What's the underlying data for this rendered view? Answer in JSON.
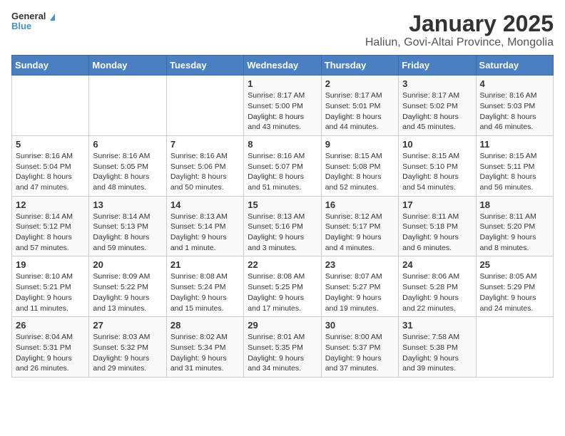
{
  "logo": {
    "general": "General",
    "blue": "Blue"
  },
  "title": "January 2025",
  "subtitle": "Haliun, Govi-Altai Province, Mongolia",
  "days_of_week": [
    "Sunday",
    "Monday",
    "Tuesday",
    "Wednesday",
    "Thursday",
    "Friday",
    "Saturday"
  ],
  "weeks": [
    [
      {
        "day": "",
        "info": ""
      },
      {
        "day": "",
        "info": ""
      },
      {
        "day": "",
        "info": ""
      },
      {
        "day": "1",
        "info": "Sunrise: 8:17 AM\nSunset: 5:00 PM\nDaylight: 8 hours\nand 43 minutes."
      },
      {
        "day": "2",
        "info": "Sunrise: 8:17 AM\nSunset: 5:01 PM\nDaylight: 8 hours\nand 44 minutes."
      },
      {
        "day": "3",
        "info": "Sunrise: 8:17 AM\nSunset: 5:02 PM\nDaylight: 8 hours\nand 45 minutes."
      },
      {
        "day": "4",
        "info": "Sunrise: 8:16 AM\nSunset: 5:03 PM\nDaylight: 8 hours\nand 46 minutes."
      }
    ],
    [
      {
        "day": "5",
        "info": "Sunrise: 8:16 AM\nSunset: 5:04 PM\nDaylight: 8 hours\nand 47 minutes."
      },
      {
        "day": "6",
        "info": "Sunrise: 8:16 AM\nSunset: 5:05 PM\nDaylight: 8 hours\nand 48 minutes."
      },
      {
        "day": "7",
        "info": "Sunrise: 8:16 AM\nSunset: 5:06 PM\nDaylight: 8 hours\nand 50 minutes."
      },
      {
        "day": "8",
        "info": "Sunrise: 8:16 AM\nSunset: 5:07 PM\nDaylight: 8 hours\nand 51 minutes."
      },
      {
        "day": "9",
        "info": "Sunrise: 8:15 AM\nSunset: 5:08 PM\nDaylight: 8 hours\nand 52 minutes."
      },
      {
        "day": "10",
        "info": "Sunrise: 8:15 AM\nSunset: 5:10 PM\nDaylight: 8 hours\nand 54 minutes."
      },
      {
        "day": "11",
        "info": "Sunrise: 8:15 AM\nSunset: 5:11 PM\nDaylight: 8 hours\nand 56 minutes."
      }
    ],
    [
      {
        "day": "12",
        "info": "Sunrise: 8:14 AM\nSunset: 5:12 PM\nDaylight: 8 hours\nand 57 minutes."
      },
      {
        "day": "13",
        "info": "Sunrise: 8:14 AM\nSunset: 5:13 PM\nDaylight: 8 hours\nand 59 minutes."
      },
      {
        "day": "14",
        "info": "Sunrise: 8:13 AM\nSunset: 5:14 PM\nDaylight: 9 hours\nand 1 minute."
      },
      {
        "day": "15",
        "info": "Sunrise: 8:13 AM\nSunset: 5:16 PM\nDaylight: 9 hours\nand 3 minutes."
      },
      {
        "day": "16",
        "info": "Sunrise: 8:12 AM\nSunset: 5:17 PM\nDaylight: 9 hours\nand 4 minutes."
      },
      {
        "day": "17",
        "info": "Sunrise: 8:11 AM\nSunset: 5:18 PM\nDaylight: 9 hours\nand 6 minutes."
      },
      {
        "day": "18",
        "info": "Sunrise: 8:11 AM\nSunset: 5:20 PM\nDaylight: 9 hours\nand 8 minutes."
      }
    ],
    [
      {
        "day": "19",
        "info": "Sunrise: 8:10 AM\nSunset: 5:21 PM\nDaylight: 9 hours\nand 11 minutes."
      },
      {
        "day": "20",
        "info": "Sunrise: 8:09 AM\nSunset: 5:22 PM\nDaylight: 9 hours\nand 13 minutes."
      },
      {
        "day": "21",
        "info": "Sunrise: 8:08 AM\nSunset: 5:24 PM\nDaylight: 9 hours\nand 15 minutes."
      },
      {
        "day": "22",
        "info": "Sunrise: 8:08 AM\nSunset: 5:25 PM\nDaylight: 9 hours\nand 17 minutes."
      },
      {
        "day": "23",
        "info": "Sunrise: 8:07 AM\nSunset: 5:27 PM\nDaylight: 9 hours\nand 19 minutes."
      },
      {
        "day": "24",
        "info": "Sunrise: 8:06 AM\nSunset: 5:28 PM\nDaylight: 9 hours\nand 22 minutes."
      },
      {
        "day": "25",
        "info": "Sunrise: 8:05 AM\nSunset: 5:29 PM\nDaylight: 9 hours\nand 24 minutes."
      }
    ],
    [
      {
        "day": "26",
        "info": "Sunrise: 8:04 AM\nSunset: 5:31 PM\nDaylight: 9 hours\nand 26 minutes."
      },
      {
        "day": "27",
        "info": "Sunrise: 8:03 AM\nSunset: 5:32 PM\nDaylight: 9 hours\nand 29 minutes."
      },
      {
        "day": "28",
        "info": "Sunrise: 8:02 AM\nSunset: 5:34 PM\nDaylight: 9 hours\nand 31 minutes."
      },
      {
        "day": "29",
        "info": "Sunrise: 8:01 AM\nSunset: 5:35 PM\nDaylight: 9 hours\nand 34 minutes."
      },
      {
        "day": "30",
        "info": "Sunrise: 8:00 AM\nSunset: 5:37 PM\nDaylight: 9 hours\nand 37 minutes."
      },
      {
        "day": "31",
        "info": "Sunrise: 7:58 AM\nSunset: 5:38 PM\nDaylight: 9 hours\nand 39 minutes."
      },
      {
        "day": "",
        "info": ""
      }
    ]
  ]
}
